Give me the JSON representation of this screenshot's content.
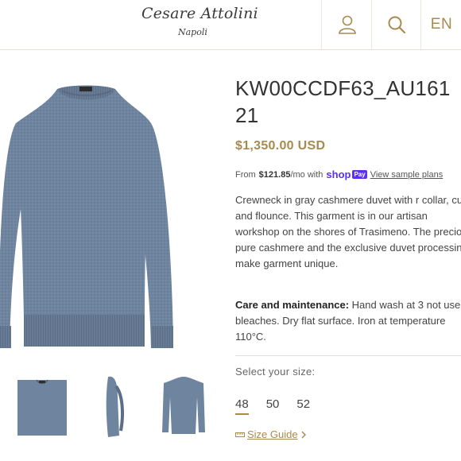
{
  "header": {
    "logo_line1": "Cesare Attolini",
    "logo_line2": "Napoli",
    "user_icon": "user-icon",
    "search_icon": "search-icon",
    "language": "EN"
  },
  "product": {
    "title": "KW00CCDF63_AU161\n21",
    "price": "$1,350.00 USD",
    "installment": {
      "prefix": "From",
      "amount": "$121.85",
      "suffix": "/mo with",
      "shop": "shop",
      "pay": "Pay",
      "link": "View sample plans"
    },
    "description": "Crewneck in gray cashmere duvet with r collar, cuffs and flounce. This garment is in our artisan workshop on the shores of Trasimeno. The precious pure cashmere and the exclusive duvet processing make garment unique.",
    "care_label": "Care and maintenance:",
    "care_text": " Hand wash at 3 not use bleaches. Dry flat surface. Iron at temperature 110°C."
  },
  "sizes": {
    "label": "Select your size:",
    "options": [
      "48",
      "50",
      "52"
    ],
    "selected": "48"
  },
  "size_guide": "Size Guide",
  "colors": {
    "accent": "#a88a4f",
    "sweater": "#6f849e",
    "shop_pay": "#5a31f4"
  }
}
